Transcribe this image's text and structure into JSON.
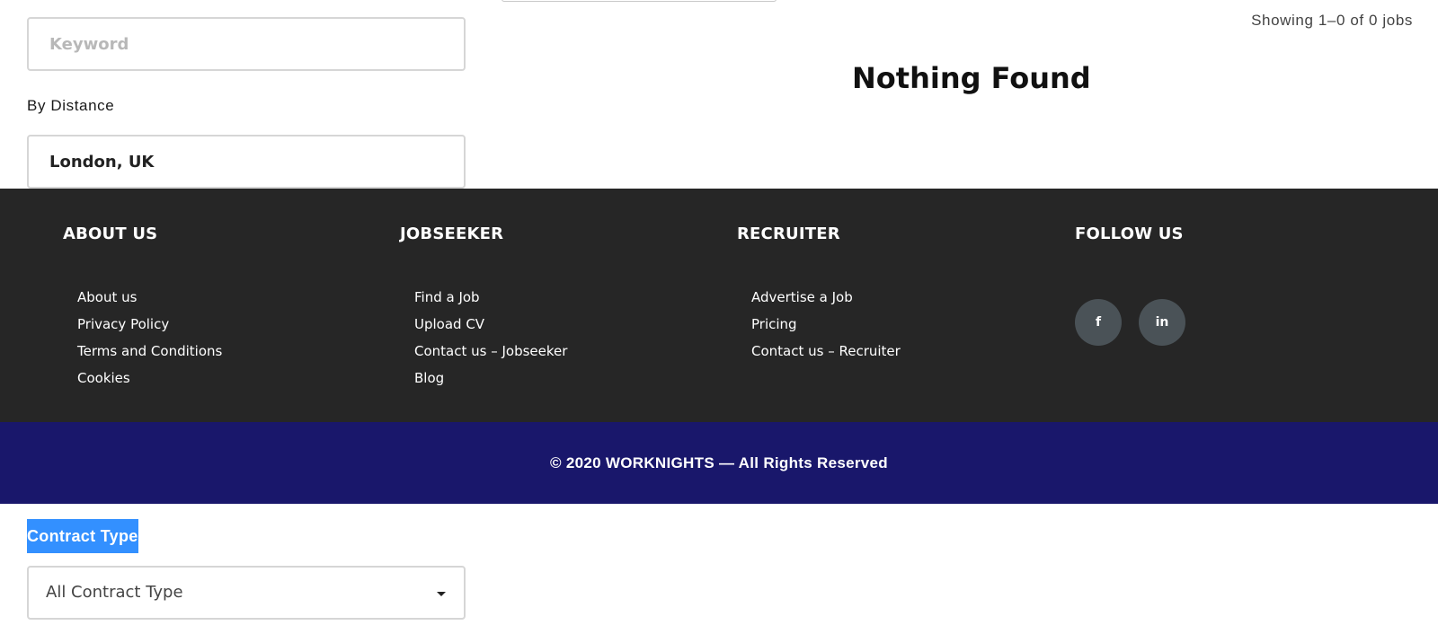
{
  "search": {
    "keyword_placeholder": "Keyword",
    "keyword_value": "",
    "distance_label": "By Distance",
    "location_value": "London, UK"
  },
  "results": {
    "count_text": "Showing 1–0 of 0 jobs",
    "empty_message": "Nothing Found"
  },
  "footer": {
    "about": {
      "heading": "ABOUT US",
      "links": [
        "About us",
        "Privacy Policy",
        "Terms and Conditions",
        "Cookies"
      ]
    },
    "jobseeker": {
      "heading": "JOBSEEKER",
      "links": [
        "Find a Job",
        "Upload CV",
        "Contact us – Jobseeker",
        "Blog"
      ]
    },
    "recruiter": {
      "heading": "RECRUITER",
      "links": [
        "Advertise a Job",
        "Pricing",
        "Contact us – Recruiter"
      ]
    },
    "follow": {
      "heading": "FOLLOW US",
      "icons": [
        "facebook-icon",
        "linkedin-icon"
      ]
    },
    "copyright": "© 2020 WORKNIGHTS — All Rights Reserved"
  },
  "filters": {
    "contract_type_label": "Contract Type",
    "contract_type_selected": "All Contract Type"
  },
  "colors": {
    "footer_bg": "#262626",
    "copyright_bg": "#19176b",
    "social_bg": "#4a5257",
    "selection_highlight": "#3390ff"
  }
}
